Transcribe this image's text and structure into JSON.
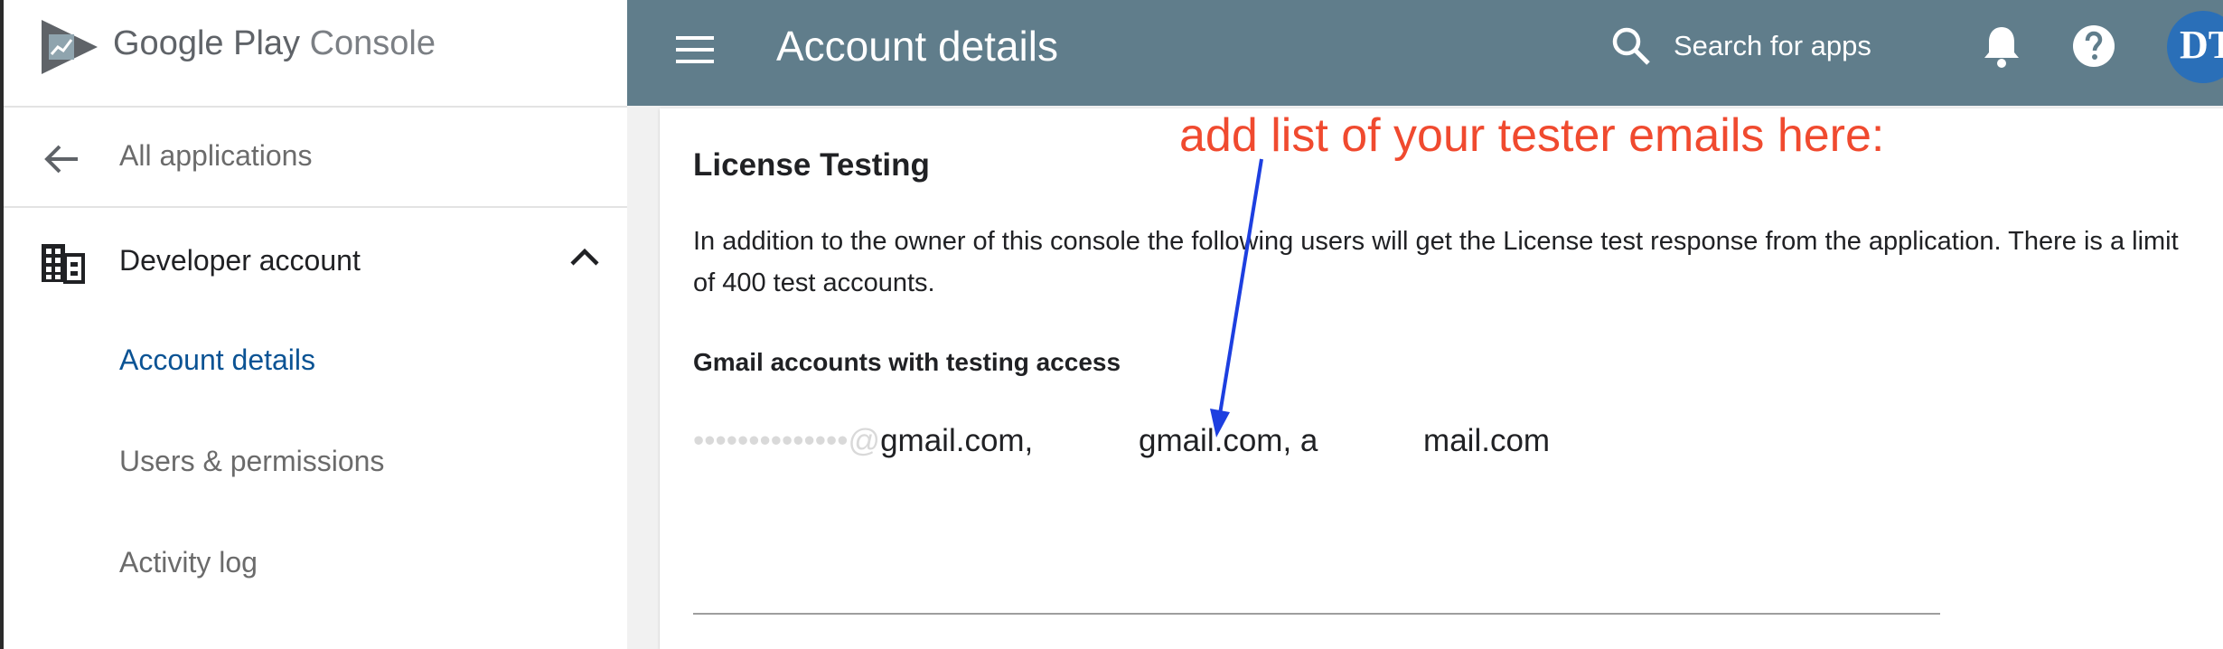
{
  "sidebar": {
    "brand": {
      "name": "Google Play",
      "suffix": "Console"
    },
    "back_label": "All applications",
    "section_label": "Developer account",
    "items": [
      {
        "label": "Account details",
        "active": true
      },
      {
        "label": "Users & permissions",
        "active": false
      },
      {
        "label": "Activity log",
        "active": false
      }
    ]
  },
  "topbar": {
    "title": "Account details",
    "search_placeholder": "Search for apps",
    "avatar_text": "DT"
  },
  "content": {
    "section_title": "License Testing",
    "description": "In addition to the owner of this console the following users will get the License test response from the application. There is a limit of 400 test accounts.",
    "field_label": "Gmail accounts with testing access",
    "emails_value": "gmail.com,            gmail.com, a            mail.com"
  },
  "annotation": {
    "text": "add list of your tester emails here:",
    "color": "#f04a2f",
    "arrow_color": "#1d3fe0"
  },
  "colors": {
    "topbar": "#607d8b",
    "active_link": "#0b5394"
  },
  "icons": [
    "google-play-console-logo",
    "back-arrow-icon",
    "building-icon",
    "chevron-up-icon",
    "hamburger-menu-icon",
    "search-icon",
    "bell-icon",
    "help-icon"
  ]
}
